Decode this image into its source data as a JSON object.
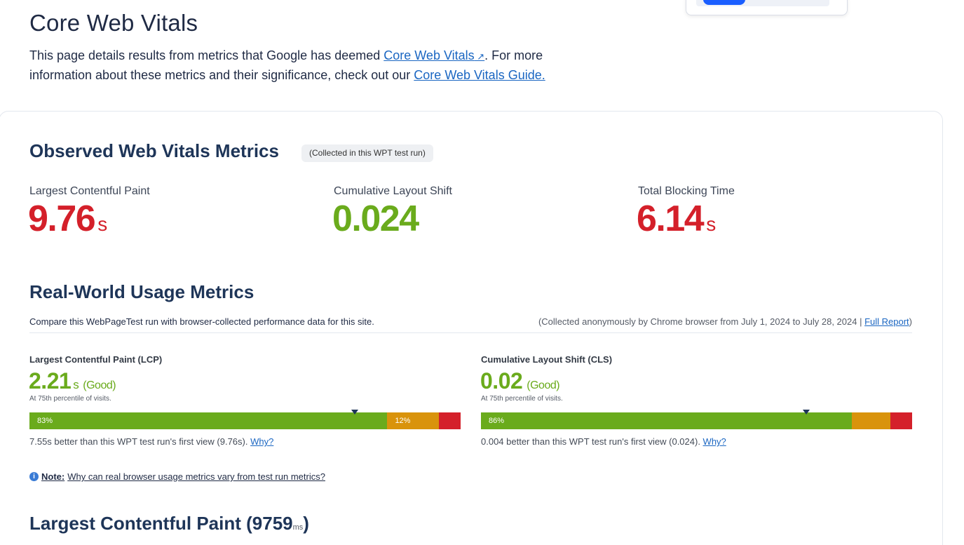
{
  "page": {
    "title": "Core Web Vitals",
    "intro_before": "This page details results from metrics that Google has deemed ",
    "intro_link1": "Core Web Vitals",
    "intro_middle": ". For more information about these metrics and their significance, check out our ",
    "intro_link2": "Core Web Vitals Guide."
  },
  "observed": {
    "heading": "Observed Web Vitals Metrics",
    "pill": "(Collected in this WPT test run)",
    "metrics": [
      {
        "label": "Largest Contentful Paint",
        "value": "9.76",
        "unit": "s",
        "color": "#d4202a"
      },
      {
        "label": "Cumulative Layout Shift",
        "value": "0.024",
        "unit": "",
        "color": "#6aab1c"
      },
      {
        "label": "Total Blocking Time",
        "value": "6.14",
        "unit": "s",
        "color": "#d4202a"
      }
    ]
  },
  "realworld": {
    "heading": "Real-World Usage Metrics",
    "description": "Compare this WebPageTest run with browser-collected performance data for this site.",
    "collected_text": "(Collected anonymously by Chrome browser from July 1, 2024 to July 28, 2024 | ",
    "full_report": "Full Report",
    "collected_close": ")",
    "lcp": {
      "title": "Largest Contentful Paint (LCP)",
      "value": "2.21",
      "unit": "s",
      "rating": "(Good)",
      "percentile": "At 75th percentile of visits.",
      "good_pct": 83,
      "ni_pct": 12,
      "poor_pct": 5,
      "good_label": "83%",
      "ni_label": "12%",
      "marker_fraction": 0.755,
      "compare_text": "7.55s better than this WPT test run's first view (9.76s). ",
      "why": "Why?"
    },
    "cls": {
      "title": "Cumulative Layout Shift (CLS)",
      "value": "0.02",
      "rating": "(Good)",
      "percentile": "At 75th percentile of visits.",
      "good_pct": 86,
      "ni_pct": 9,
      "poor_pct": 5,
      "good_label": "86%",
      "marker_fraction": 0.755,
      "compare_text": "0.004 better than this WPT test run's first view (0.024). ",
      "why": "Why?"
    },
    "note_label": "Note:",
    "note_link": "Why can real browser usage metrics vary from test run metrics?"
  },
  "lcp_section": {
    "heading": "Largest Contentful Paint (",
    "value": "9759",
    "unit": "ms",
    "close": ")"
  }
}
